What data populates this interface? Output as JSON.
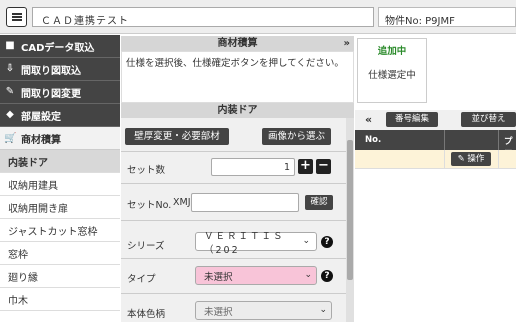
{
  "header": {
    "menu_icon": "hamburger-icon",
    "title": "ＣＡＤ連携テスト",
    "property_label": "物件No: P9JMF"
  },
  "sidebar": {
    "dark_items": [
      {
        "icon": "box-icon",
        "label": "CADデータ取込"
      },
      {
        "icon": "import-icon",
        "label": "間取り図取込"
      },
      {
        "icon": "edit-icon",
        "label": "間取り図変更"
      },
      {
        "icon": "tag-icon",
        "label": "部屋設定"
      }
    ],
    "section": {
      "icon": "cart-icon",
      "label": "商材積算"
    },
    "items": [
      {
        "label": "内装ドア",
        "active": true
      },
      {
        "label": "収納用建具"
      },
      {
        "label": "収納用開き扉"
      },
      {
        "label": "ジャストカット窓枠"
      },
      {
        "label": "窓枠"
      },
      {
        "label": "廻り縁"
      },
      {
        "label": "巾木"
      }
    ]
  },
  "middle": {
    "header": "商材積算",
    "collapse_icon": "»",
    "instruction": "仕様を選択後、仕様確定ボタンを押してください。",
    "section_title": "内装ドア",
    "btn_wall": "壁厚変更・必要部材",
    "btn_image": "画像から選ぶ",
    "set_count_label": "セット数",
    "set_count_value": "1",
    "set_no_label": "セットNo.",
    "set_no_prefix": "XMJ",
    "confirm_label": "確認",
    "series_label": "シリーズ",
    "series_value": "ＶＥＲＩＴＩＳ（202",
    "type_label": "タイプ",
    "type_value": "未選択",
    "body_color_label": "本体色柄",
    "body_color_value": "未選択",
    "help_icon": "?",
    "plus": "+",
    "minus": "−"
  },
  "right": {
    "add_label": "追加中",
    "add_text": "仕様選定中",
    "back_icon": "«",
    "btn_number_edit": "番号編集",
    "btn_sort": "並び替え",
    "col_no": "No.",
    "col_pro": "プロ",
    "btn_operation": "操作"
  }
}
